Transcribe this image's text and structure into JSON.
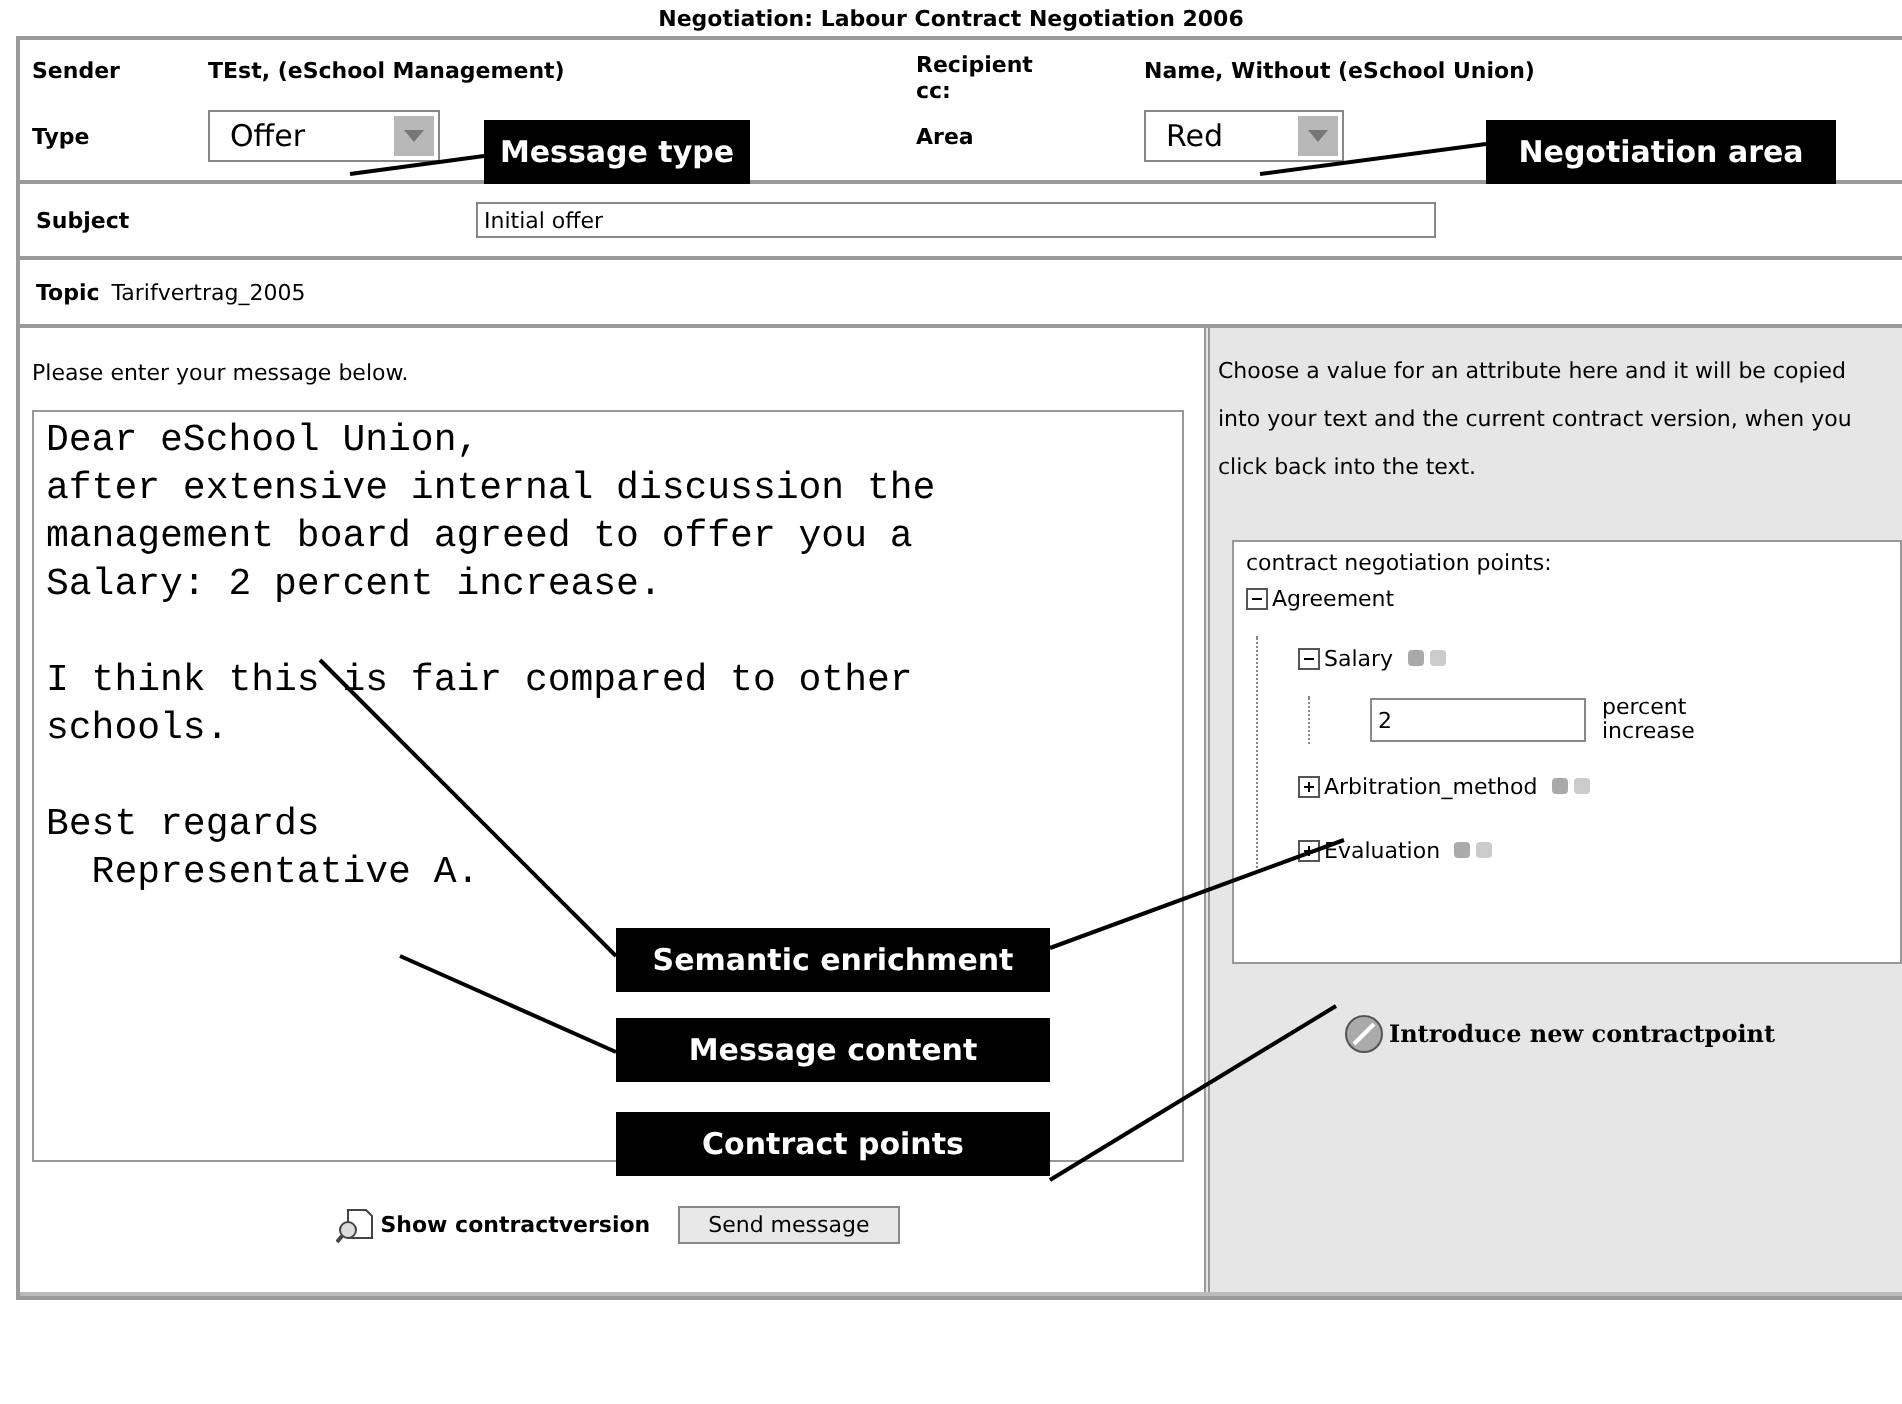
{
  "title": "Negotiation: Labour Contract Negotiation 2006",
  "header": {
    "sender_label": "Sender",
    "sender": "TEst, (eSchool Management)",
    "recipient_label": "Recipient",
    "cc_label": "cc:",
    "recipient": "Name, Without (eSchool Union)",
    "type_label": "Type",
    "type_value": "Offer",
    "area_label": "Area",
    "area_value": "Red"
  },
  "subject": {
    "label": "Subject",
    "value": "Initial offer"
  },
  "topic": {
    "label": "Topic",
    "value": "Tarifvertrag_2005"
  },
  "message": {
    "prompt": "Please enter your message below.",
    "text": "Dear eSchool Union,\nafter extensive internal discussion the\nmanagement board agreed to offer you a\nSalary: 2 percent increase.\n\nI think this is fair compared to other\nschools.\n\nBest regards\n  Representative A."
  },
  "footer": {
    "show_link": "Show contractversion",
    "send_button": "Send message"
  },
  "side": {
    "hint": "Choose a value for an attribute here and it will be copied into your text and the current contract version, when you click back into the text.",
    "tree_title": "contract negotiation points:",
    "tree": [
      {
        "label": "Agreement",
        "expanded": true,
        "children": [
          {
            "label": "Salary",
            "expanded": true,
            "children": [
              {
                "kind": "input",
                "value": "2",
                "unit": "percent increase"
              }
            ]
          },
          {
            "label": "Arbitration_method",
            "expanded": false
          },
          {
            "label": "Evaluation",
            "expanded": false
          }
        ]
      }
    ],
    "new_point": "Introduce new contractpoint"
  },
  "annotations": [
    {
      "text": "Message type"
    },
    {
      "text": "Negotiation area"
    },
    {
      "text": "Semantic enrichment"
    },
    {
      "text": "Message content"
    },
    {
      "text": "Contract points"
    }
  ]
}
